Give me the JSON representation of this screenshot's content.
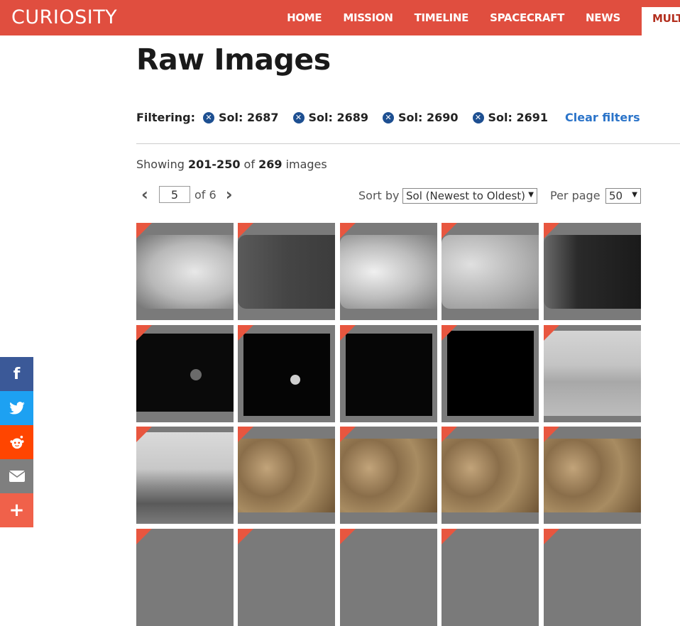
{
  "header": {
    "brand": "CURIOSITY",
    "nav": [
      "HOME",
      "MISSION",
      "TIMELINE",
      "SPACECRAFT",
      "NEWS",
      "MULT"
    ]
  },
  "page": {
    "title": "Raw Images"
  },
  "filters": {
    "label": "Filtering:",
    "chips": [
      "Sol: 2687",
      "Sol: 2689",
      "Sol: 2690",
      "Sol: 2691"
    ],
    "clear_label": "Clear filters"
  },
  "results": {
    "prefix": "Showing",
    "range": "201-250",
    "of_word": "of",
    "total": "269",
    "suffix": "images"
  },
  "pagination": {
    "prev_icon": "chevron-left-icon",
    "current_page": "5",
    "of_label": "of",
    "total_pages": "6",
    "next_icon": "chevron-right-icon"
  },
  "sort": {
    "label": "Sort by",
    "value": "Sol (Newest to Oldest)"
  },
  "per_page": {
    "label": "Per page",
    "value": "50"
  },
  "colors": {
    "header": "#e04e3f",
    "chip": "#1d4f91",
    "link": "#2b74c9",
    "flag": "#e8563f"
  },
  "share": {
    "items": [
      {
        "icon": "facebook-icon",
        "glyph": "f",
        "color": "#3b5998"
      },
      {
        "icon": "twitter-icon",
        "glyph": "🐦",
        "color": "#1da1f2"
      },
      {
        "icon": "reddit-icon",
        "glyph": "👽",
        "color": "#ff4500"
      },
      {
        "icon": "email-icon",
        "glyph": "✉",
        "color": "#7f7f7f"
      },
      {
        "icon": "plus-icon",
        "glyph": "+",
        "color": "#f0614a"
      }
    ]
  }
}
